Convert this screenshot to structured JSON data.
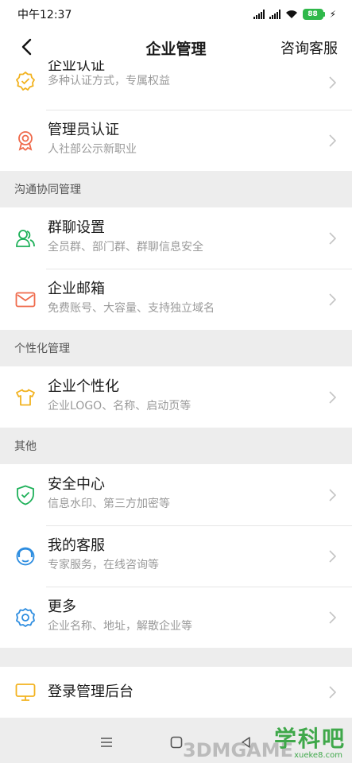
{
  "status": {
    "time": "中午12:37",
    "battery": "88",
    "network": "4G"
  },
  "nav": {
    "title": "企业管理",
    "right": "咨询客服"
  },
  "top_group": [
    {
      "title": "企业认证",
      "subtitle": "多种认证方式，专属权益",
      "icon": "verified-badge-icon",
      "color": "#f2b21f"
    },
    {
      "title": "管理员认证",
      "subtitle": "人社部公示新职业",
      "icon": "medal-icon",
      "color": "#ef6a4b"
    }
  ],
  "sections": [
    {
      "label": "沟通协同管理",
      "items": [
        {
          "title": "群聊设置",
          "subtitle": "全员群、部门群、群聊信息安全",
          "icon": "group-chat-icon",
          "color": "#1fb15a"
        },
        {
          "title": "企业邮箱",
          "subtitle": "免费账号、大容量、支持独立域名",
          "icon": "mail-icon",
          "color": "#ef6a4b"
        }
      ]
    },
    {
      "label": "个性化管理",
      "items": [
        {
          "title": "企业个性化",
          "subtitle": "企业LOGO、名称、启动页等",
          "icon": "tshirt-icon",
          "color": "#f2b21f"
        }
      ]
    },
    {
      "label": "其他",
      "items": [
        {
          "title": "安全中心",
          "subtitle": "信息水印、第三方加密等",
          "icon": "shield-icon",
          "color": "#1fb15a"
        },
        {
          "title": "我的客服",
          "subtitle": "专家服务，在线咨询等",
          "icon": "headset-icon",
          "color": "#2d8de0"
        },
        {
          "title": "更多",
          "subtitle": "企业名称、地址，解散企业等",
          "icon": "gear-icon",
          "color": "#2d8de0"
        }
      ]
    }
  ],
  "bottom_item": {
    "title": "登录管理后台",
    "icon": "monitor-icon",
    "color": "#f2b21f"
  },
  "home_bar": {
    "menu_icon": "menu-icon",
    "home_icon": "home-square-icon",
    "back_icon": "back-triangle-icon"
  },
  "watermark": {
    "text": "学科吧",
    "sub": "xueke8.com",
    "brand": "3DMGAME"
  }
}
